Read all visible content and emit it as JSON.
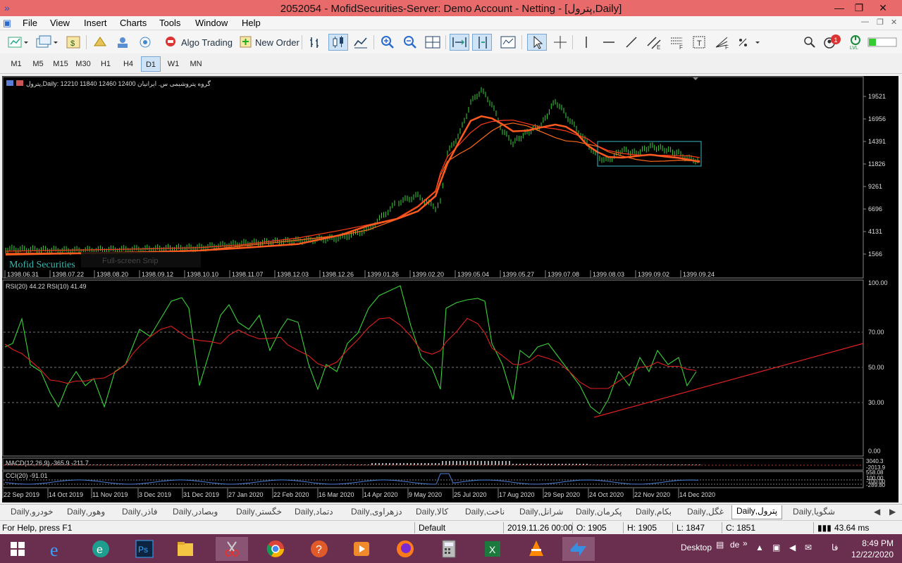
{
  "window": {
    "title": "2052054 - MofidSecurities-Server: Demo Account - Netting - [پترول,Daily]"
  },
  "menu": {
    "items": [
      "File",
      "View",
      "Insert",
      "Charts",
      "Tools",
      "Window",
      "Help"
    ]
  },
  "toolbar": {
    "algo_label": "Algo Trading",
    "order_label": "New Order",
    "notif_count": "1",
    "lvl_label": "LVL"
  },
  "timeframes": [
    "M1",
    "M5",
    "M15",
    "M30",
    "H1",
    "H4",
    "D1",
    "W1",
    "MN"
  ],
  "chart": {
    "header": "پترول,Daily:  12210 11840 12460 12400  گروه پتروشیمی س. ایرانیان",
    "watermark": "Mofid Securities",
    "snip_label": "Full-screen Snip",
    "price_ticks": [
      "19521",
      "16956",
      "14391",
      "11826",
      "9261",
      "6696",
      "4131",
      "1566"
    ],
    "price_dates": [
      "1398.06.31",
      "1398.07.22",
      "1398.08.20",
      "1398.09.12",
      "1398.10.10",
      "1398.11.07",
      "1398.12.03",
      "1398.12.26",
      "1399.01.26",
      "1399.02.20",
      "1399.05.04",
      "1399.05.27",
      "1399.07.08",
      "1399.08.03",
      "1399.09.02",
      "1399.09.24"
    ],
    "rsi_label": "RSI(20) 44.22 RSI(10) 41.49",
    "rsi_ticks": [
      "100.00",
      "70.00",
      "50.00",
      "30.00",
      "0.00"
    ],
    "macd_label": "MACD(12,26,9) -365.9 -211.7",
    "macd_ticks": [
      "3040.3",
      "-2013.9"
    ],
    "cci_label": "CCI(20) -91.01",
    "cci_ticks": [
      "558.08",
      "100.00",
      "-100.00",
      "-289.80"
    ],
    "bottom_dates": [
      "22 Sep 2019",
      "14 Oct 2019",
      "11 Nov 2019",
      "3 Dec 2019",
      "31 Dec 2019",
      "27 Jan 2020",
      "22 Feb 2020",
      "16 Mar 2020",
      "14 Apr 2020",
      "9 May 2020",
      "25 Jul 2020",
      "17 Aug 2020",
      "29 Sep 2020",
      "24 Oct 2020",
      "22 Nov 2020",
      "14 Dec 2020"
    ]
  },
  "tabs": [
    "خودرو,Daily",
    "وهور,Daily",
    "فاذر,Daily",
    "وبصادر,Daily",
    "خگستر,Daily",
    "دتماد,Daily",
    "دزهراوی,Daily",
    "کالا,Daily",
    "ناخت,Daily",
    "شرانل,Daily",
    "پکرمان,Daily",
    "بکام,Daily",
    "غگل,Daily",
    "پترول,Daily",
    "شگویا,Daily"
  ],
  "status": {
    "help": "For Help, press F1",
    "profile": "Default",
    "datetime": "2019.11.26 00:00",
    "open": "O: 1905",
    "high": "H: 1905",
    "low": "L: 1847",
    "close": "C: 1851",
    "ping": "43.64 ms"
  },
  "taskbar": {
    "desktop_label": "Desktop",
    "lang": "de",
    "lang2": "فا",
    "time": "8:49 PM",
    "date": "12/22/2020"
  }
}
